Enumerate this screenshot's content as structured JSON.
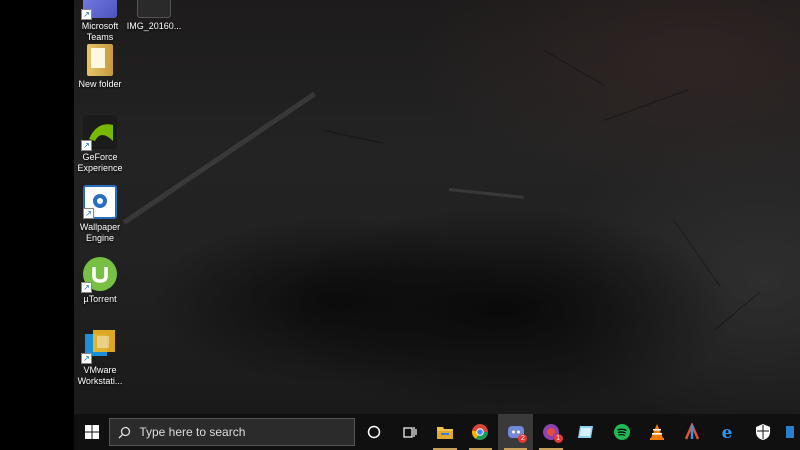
{
  "desktop": {
    "icons": [
      {
        "label": "Microsoft\nTeams",
        "icon": "teams-icon"
      },
      {
        "label": "IMG_20160...",
        "icon": "image-file-icon"
      },
      {
        "label": "New folder",
        "icon": "folder-icon"
      },
      {
        "label": "GeForce\nExperience",
        "icon": "geforce-icon"
      },
      {
        "label": "Wallpaper\nEngine",
        "icon": "wallpaper-engine-icon"
      },
      {
        "label": "µTorrent",
        "icon": "utorrent-icon"
      },
      {
        "label": "VMware\nWorkstati...",
        "icon": "vmware-icon"
      }
    ]
  },
  "taskbar": {
    "search_placeholder": "Type here to search",
    "discord_badge": "2",
    "app2_badge": "1",
    "apps": [
      "start-icon",
      "search-icon",
      "cortana-icon",
      "task-view-icon",
      "file-explorer-icon",
      "chrome-icon",
      "discord-icon",
      "app-icon",
      "notes-icon",
      "spotify-icon",
      "vlc-icon",
      "audio-app-icon",
      "edge-icon",
      "security-icon",
      "overflow-icon"
    ]
  },
  "colors": {
    "taskbar_bg": "#101010",
    "open_indicator": "#c8a05a",
    "badge": "#e53935"
  }
}
